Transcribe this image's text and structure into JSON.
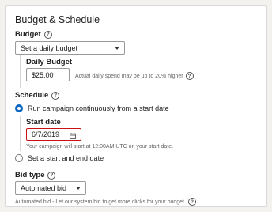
{
  "section_title": "Budget & Schedule",
  "budget": {
    "label": "Budget",
    "help_icon": "help-icon",
    "selected": "Set a daily budget",
    "daily_budget_label": "Daily Budget",
    "daily_budget_value": "$25.00",
    "daily_budget_hint": "Actual daily spend may be up to 20% higher"
  },
  "schedule": {
    "label": "Schedule",
    "option_continuous": "Run campaign continuously from a start date",
    "start_date_label": "Start date",
    "start_date_value": "6/7/2019",
    "start_date_hint": "Your campaign will start at 12:00AM UTC on your start date.",
    "option_start_end": "Set a start and end date"
  },
  "bid": {
    "label": "Bid type",
    "selected": "Automated bid",
    "hint": "Automated bid - Let our system bid to get more clicks for your budget."
  },
  "colors": {
    "accent": "#0a66c2",
    "error_border": "#cc1016"
  }
}
